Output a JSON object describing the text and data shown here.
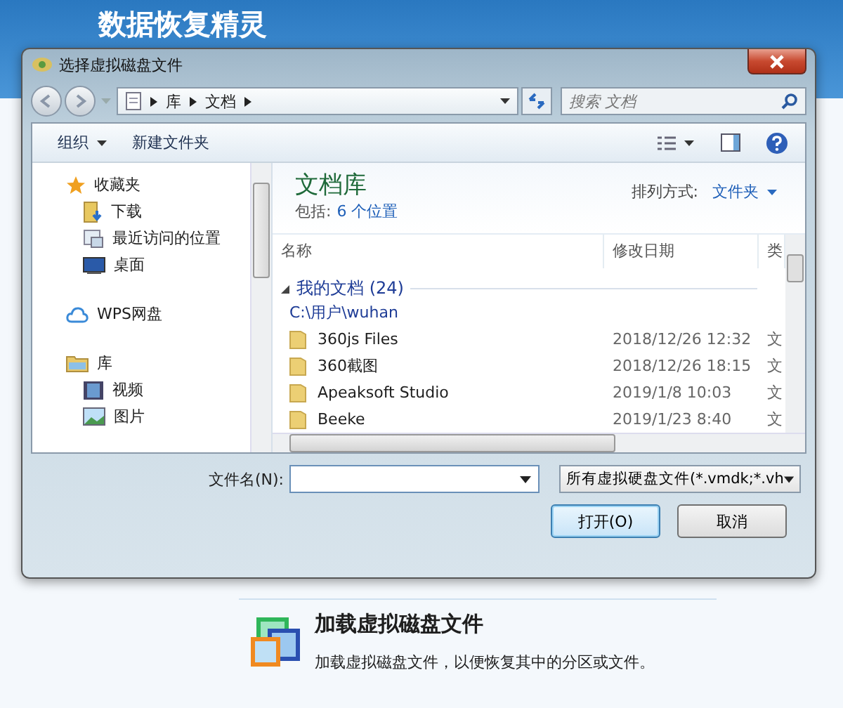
{
  "app": {
    "title": "数据恢复精灵"
  },
  "dialog": {
    "title": "选择虚拟磁盘文件",
    "breadcrumb": [
      "库",
      "文档"
    ],
    "search": {
      "placeholder": "搜索 文档"
    },
    "toolbar": {
      "organize": "组织",
      "new_folder": "新建文件夹"
    },
    "nav": [
      {
        "label": "收藏夹",
        "kind": "star",
        "children": [
          {
            "label": "下载",
            "kind": "download"
          },
          {
            "label": "最近访问的位置",
            "kind": "recent"
          },
          {
            "label": "桌面",
            "kind": "desktop"
          }
        ]
      },
      {
        "label": "WPS网盘",
        "kind": "cloud"
      },
      {
        "label": "库",
        "kind": "library",
        "children": [
          {
            "label": "视频",
            "kind": "video"
          },
          {
            "label": "图片",
            "kind": "picture"
          }
        ]
      }
    ],
    "library": {
      "title": "文档库",
      "includes_label": "包括:",
      "includes_link": "6 个位置",
      "arrange_label": "排列方式:",
      "arrange_value": "文件夹"
    },
    "columns": [
      "名称",
      "修改日期",
      "类"
    ],
    "group": {
      "title": "我的文档 (24)",
      "path": "C:\\用户\\wuhan",
      "expanded": true
    },
    "rows": [
      {
        "name": "360js Files",
        "date": "2018/12/26 12:32",
        "column_3": "文"
      },
      {
        "name": "360截图",
        "date": "2018/12/26 18:15",
        "column_3": "文"
      },
      {
        "name": "Apeaksoft Studio",
        "date": "2019/1/8 10:03",
        "column_3": "文"
      },
      {
        "name": "Beeke",
        "date": "2019/1/23 8:40",
        "column_3": "文"
      }
    ],
    "filename_label": "文件名(N):",
    "filter": "所有虚拟硬盘文件(*.vmdk;*.vh",
    "buttons": [
      {
        "label": "打开(O)",
        "default": true
      },
      {
        "label": "取消",
        "default": false
      }
    ]
  },
  "feature": {
    "title": "加载虚拟磁盘文件",
    "description": "加载虚拟磁盘文件，以便恢复其中的分区或文件。"
  }
}
